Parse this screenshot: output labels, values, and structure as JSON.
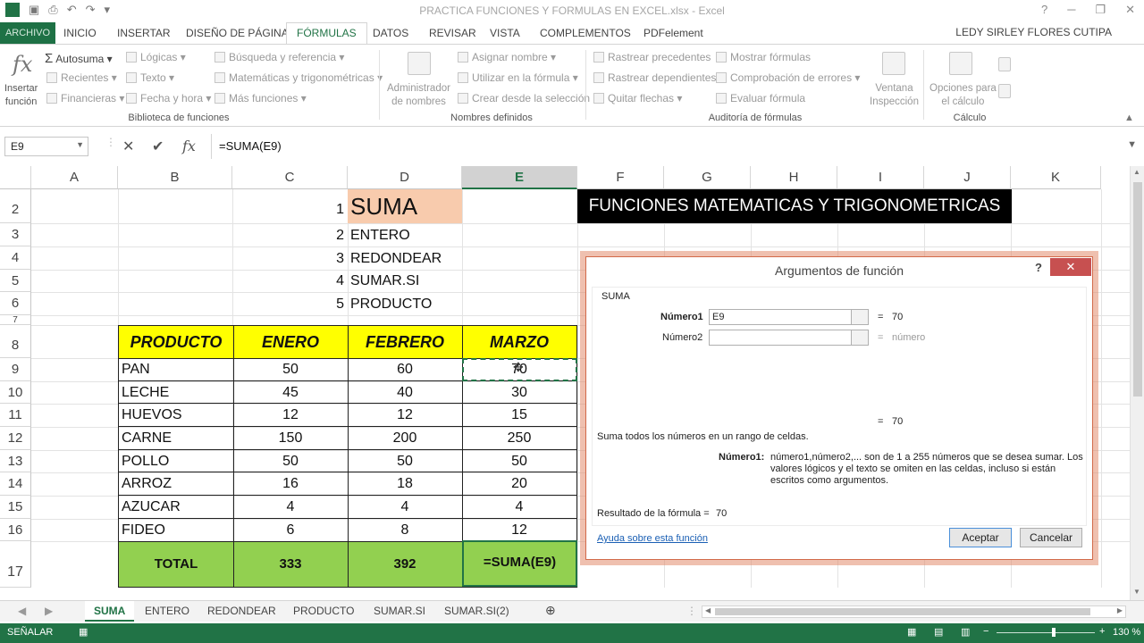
{
  "window": {
    "title": "PRACTICA FUNCIONES Y FORMULAS EN EXCEL.xlsx - Excel",
    "user": "LEDY SIRLEY FLORES CUTIPA",
    "help": "?",
    "minimize": "─",
    "restore": "❐",
    "close": "✕"
  },
  "ribbon_tabs": {
    "archivo": "ARCHIVO",
    "items": [
      "INICIO",
      "INSERTAR",
      "DISEÑO DE PÁGINA",
      "FÓRMULAS",
      "DATOS",
      "REVISAR",
      "VISTA",
      "COMPLEMENTOS",
      "PDFelement"
    ],
    "active": "FÓRMULAS"
  },
  "ribbon": {
    "insertar_funcion": "Insertar\nfunción",
    "autosuma": "Autosuma",
    "recientes": "Recientes",
    "financieras": "Financieras",
    "logicas": "Lógicas",
    "texto": "Texto",
    "fecha_hora": "Fecha y hora",
    "busqueda": "Búsqueda y referencia",
    "matematicas": "Matemáticas y trigonométricas",
    "mas_funciones": "Más funciones",
    "grp_biblioteca": "Biblioteca de funciones",
    "administrador": "Administrador\nde nombres",
    "asignar_nombre": "Asignar nombre",
    "utilizar_formula": "Utilizar en la fórmula",
    "crear_desde": "Crear desde la selección",
    "grp_nombres": "Nombres definidos",
    "rastrear_precedentes": "Rastrear precedentes",
    "rastrear_dependientes": "Rastrear dependientes",
    "quitar_flechas": "Quitar flechas",
    "mostrar_formulas": "Mostrar fórmulas",
    "comprobacion_errores": "Comprobación de errores",
    "evaluar_formula": "Evaluar fórmula",
    "ventana_inspeccion": "Ventana\nInspección",
    "grp_auditoria": "Auditoría de fórmulas",
    "opciones_calculo": "Opciones para\nel cálculo",
    "grp_calculo": "Cálculo"
  },
  "formula_bar": {
    "name_box": "E9",
    "formula": "=SUMA(E9)"
  },
  "columns": [
    "A",
    "B",
    "C",
    "D",
    "E",
    "F",
    "G",
    "H",
    "I",
    "J",
    "K"
  ],
  "selected_column": "E",
  "rows": [
    "2",
    "3",
    "4",
    "5",
    "6",
    "7",
    "8",
    "9",
    "10",
    "11",
    "12",
    "13",
    "14",
    "15",
    "16",
    "17"
  ],
  "function_list": {
    "numbers": [
      "1",
      "2",
      "3",
      "4",
      "5"
    ],
    "names": [
      "SUMA",
      "ENTERO",
      "REDONDEAR",
      "SUMAR.SI",
      "PRODUCTO"
    ]
  },
  "banner": "FUNCIONES MATEMATICAS Y TRIGONOMETRICAS",
  "table": {
    "headers": [
      "PRODUCTO",
      "ENERO",
      "FEBRERO",
      "MARZO"
    ],
    "rows": [
      [
        "PAN",
        "50",
        "60",
        "70"
      ],
      [
        "LECHE",
        "45",
        "40",
        "30"
      ],
      [
        "HUEVOS",
        "12",
        "12",
        "15"
      ],
      [
        "CARNE",
        "150",
        "200",
        "250"
      ],
      [
        "POLLO",
        "50",
        "50",
        "50"
      ],
      [
        "ARROZ",
        "16",
        "18",
        "20"
      ],
      [
        "AZUCAR",
        "4",
        "4",
        "4"
      ],
      [
        "FIDEO",
        "6",
        "8",
        "12"
      ]
    ],
    "total": [
      "TOTAL",
      "333",
      "392",
      "=SUMA(E9)"
    ],
    "header_color": "#ffff00",
    "total_color": "#92d050"
  },
  "dialog": {
    "title": "Argumentos de función",
    "function_name": "SUMA",
    "arg1_label": "Número1",
    "arg1_value": "E9",
    "arg1_result": "70",
    "arg2_label": "Número2",
    "arg2_result": "número",
    "eq": "=",
    "total_result": "70",
    "description": "Suma todos los números en un rango de celdas.",
    "arg_help_label": "Número1:",
    "arg_help_text": "número1,número2,... son de 1 a 255 números que se desea sumar. Los valores lógicos y el texto se omiten en las celdas, incluso si están escritos como argumentos.",
    "result_label": "Resultado de la fórmula =",
    "result_value": "70",
    "help_link": "Ayuda sobre esta función",
    "ok_button": "Aceptar",
    "cancel_button": "Cancelar"
  },
  "sheet_tabs": [
    "SUMA",
    "ENTERO",
    "REDONDEAR",
    "PRODUCTO",
    "SUMAR.SI",
    "SUMAR.SI(2)"
  ],
  "active_sheet": "SUMA",
  "status": {
    "mode": "SEÑALAR",
    "zoom": "130 %"
  }
}
